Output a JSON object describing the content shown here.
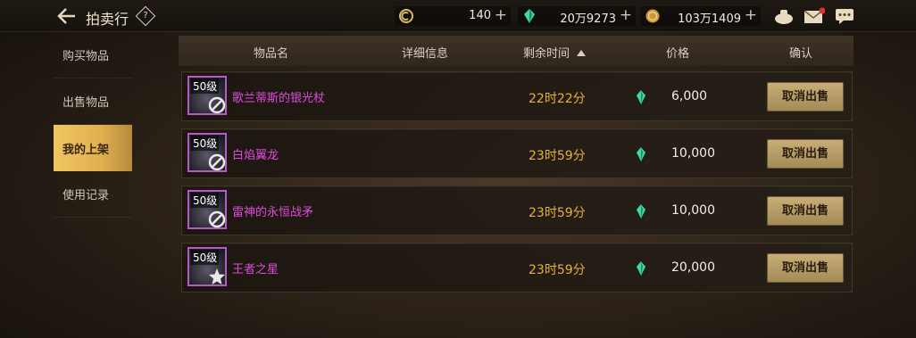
{
  "header": {
    "title": "拍卖行",
    "help_label": "?",
    "currencies": [
      {
        "icon": "gold-coin-icon",
        "value": "140"
      },
      {
        "icon": "green-gem-icon",
        "value": "20万9273"
      },
      {
        "icon": "gold-medal-icon",
        "value": "103万1409"
      }
    ],
    "plus_label": "+"
  },
  "sidebar": {
    "items": [
      {
        "label": "购买物品",
        "active": false
      },
      {
        "label": "出售物品",
        "active": false
      },
      {
        "label": "我的上架",
        "active": true
      },
      {
        "label": "使用记录",
        "active": false
      }
    ]
  },
  "table": {
    "headers": {
      "name": "物品名",
      "detail": "详细信息",
      "remaining": "剩余时间",
      "price": "价格",
      "confirm": "确认"
    },
    "rows": [
      {
        "level": "50级",
        "name": "歌兰蒂斯的银光杖",
        "remaining": "22时22分",
        "price": "6,000",
        "action": "取消出售"
      },
      {
        "level": "50级",
        "name": "白焰翼龙",
        "remaining": "23时59分",
        "price": "10,000",
        "action": "取消出售"
      },
      {
        "level": "50级",
        "name": "雷神的永恒战矛",
        "remaining": "23时59分",
        "price": "10,000",
        "action": "取消出售"
      },
      {
        "level": "50级",
        "name": "王者之星",
        "remaining": "23时59分",
        "price": "20,000",
        "action": "取消出售"
      }
    ]
  },
  "colors": {
    "item_name": "#e04ae0",
    "remaining_time": "#e8b040",
    "active_tab": "#f0c660",
    "button": "#c8ad78",
    "gem": "#3ed8a8"
  }
}
